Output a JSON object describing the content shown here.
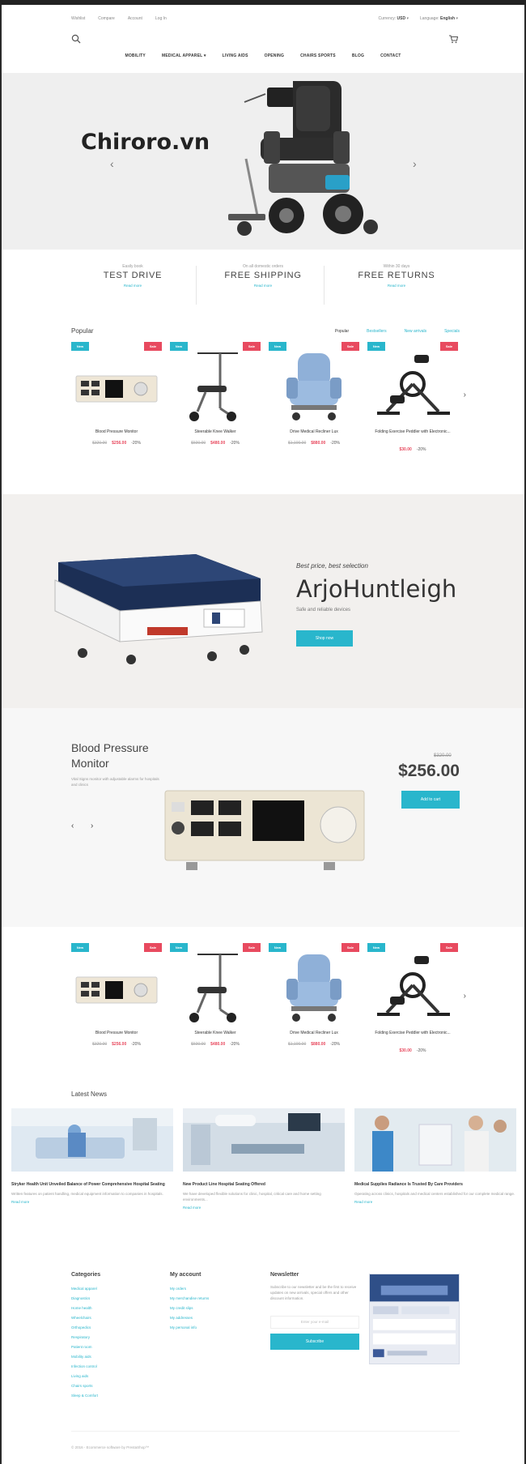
{
  "topbar": {
    "links": [
      "Wishlist",
      "Compare",
      "Account",
      "Log In"
    ],
    "currency_label": "Currency:",
    "currency_value": "USD",
    "language_label": "Language:",
    "language_value": "English"
  },
  "nav": [
    "MOBILITY",
    "MEDICAL APPAREL",
    "LIVING AIDS",
    "OPENING",
    "CHAIRS SPORTS",
    "BLOG",
    "CONTACT"
  ],
  "hero": {
    "title": "Chiroro.vn",
    "prev": "‹",
    "next": "›"
  },
  "features": [
    {
      "sub": "Easily book",
      "title": "TEST DRIVE",
      "more": "Read more"
    },
    {
      "sub": "On all domestic orders",
      "title": "FREE SHIPPING",
      "more": "Read more"
    },
    {
      "sub": "Within 30 days",
      "title": "FREE RETURNS",
      "more": "Read more"
    }
  ],
  "popular": {
    "title": "Popular",
    "tabs": [
      "Popular",
      "Bestsellers",
      "New arrivals",
      "Specials"
    ]
  },
  "products": [
    {
      "name": "Blood Pressure Monitor",
      "old": "$320.00",
      "price": "$256.00",
      "discount": "-20%",
      "new_badge": "New",
      "sale_badge": "Sale"
    },
    {
      "name": "Steerable Knee Walker",
      "old": "$600.00",
      "price": "$480.00",
      "discount": "-20%",
      "new_badge": "New",
      "sale_badge": "Sale"
    },
    {
      "name": "Drive Medical Recliner Lux",
      "old": "$1,100.00",
      "price": "$880.00",
      "discount": "-20%",
      "new_badge": "New",
      "sale_badge": "Sale"
    },
    {
      "name": "Folding Exercise Peddler with Electronic...",
      "old": "",
      "price": "$30.00",
      "discount": "-20%",
      "new_badge": "New",
      "sale_badge": "Sale"
    }
  ],
  "banner": {
    "tagline": "Best price, best selection",
    "brand": "ArjoHuntleigh",
    "sub": "Safe and reliable devices",
    "button": "Shop now"
  },
  "feature": {
    "name": "Blood Pressure Monitor",
    "desc": "Vital Signs monitor with adjustable alarms for hospitals and clinics",
    "old": "$320.00",
    "price": "$256.00",
    "button": "Add to cart",
    "prev": "‹",
    "next": "›"
  },
  "news": {
    "title": "Latest News",
    "items": [
      {
        "title": "Stryker Health Unit Unveiled Balance of Power Comprehensive Hospital Seating",
        "desc": "Written features on patient handling, medical equipment information to companies in hospitals.",
        "more": "Read more"
      },
      {
        "title": "New Product Line Hospital Seating Offered",
        "desc": "We have developed flexible solutions for clinic, hospital, critical care and home setting environments...",
        "more": "Read more"
      },
      {
        "title": "Medical Supplies Radiance Is Trusted By Care Providers",
        "desc": "Operating across clinics, hospitals and medical centers established for our complete medical range.",
        "more": "Read more"
      }
    ]
  },
  "footer": {
    "categories": {
      "title": "Categories",
      "links": [
        "Medical apparel",
        "Diagnostics",
        "Home health",
        "Wheelchairs",
        "Orthopedics",
        "Respiratory",
        "Patient room",
        "Mobility aids",
        "Infection control",
        "Living aids",
        "Chairs sports",
        "Sleep & Comfort"
      ]
    },
    "account": {
      "title": "My account",
      "links": [
        "My orders",
        "My merchandise returns",
        "My credit slips",
        "My addresses",
        "My personal info"
      ]
    },
    "newsletter": {
      "title": "Newsletter",
      "text": "Subscribe to our newsletter and be the first to receive updates on new arrivals, special offers and other discount information.",
      "placeholder": "Enter your e-mail",
      "button": "Subscribe"
    },
    "copyright": "© 2016 - Ecommerce software by PrestaShop™"
  }
}
